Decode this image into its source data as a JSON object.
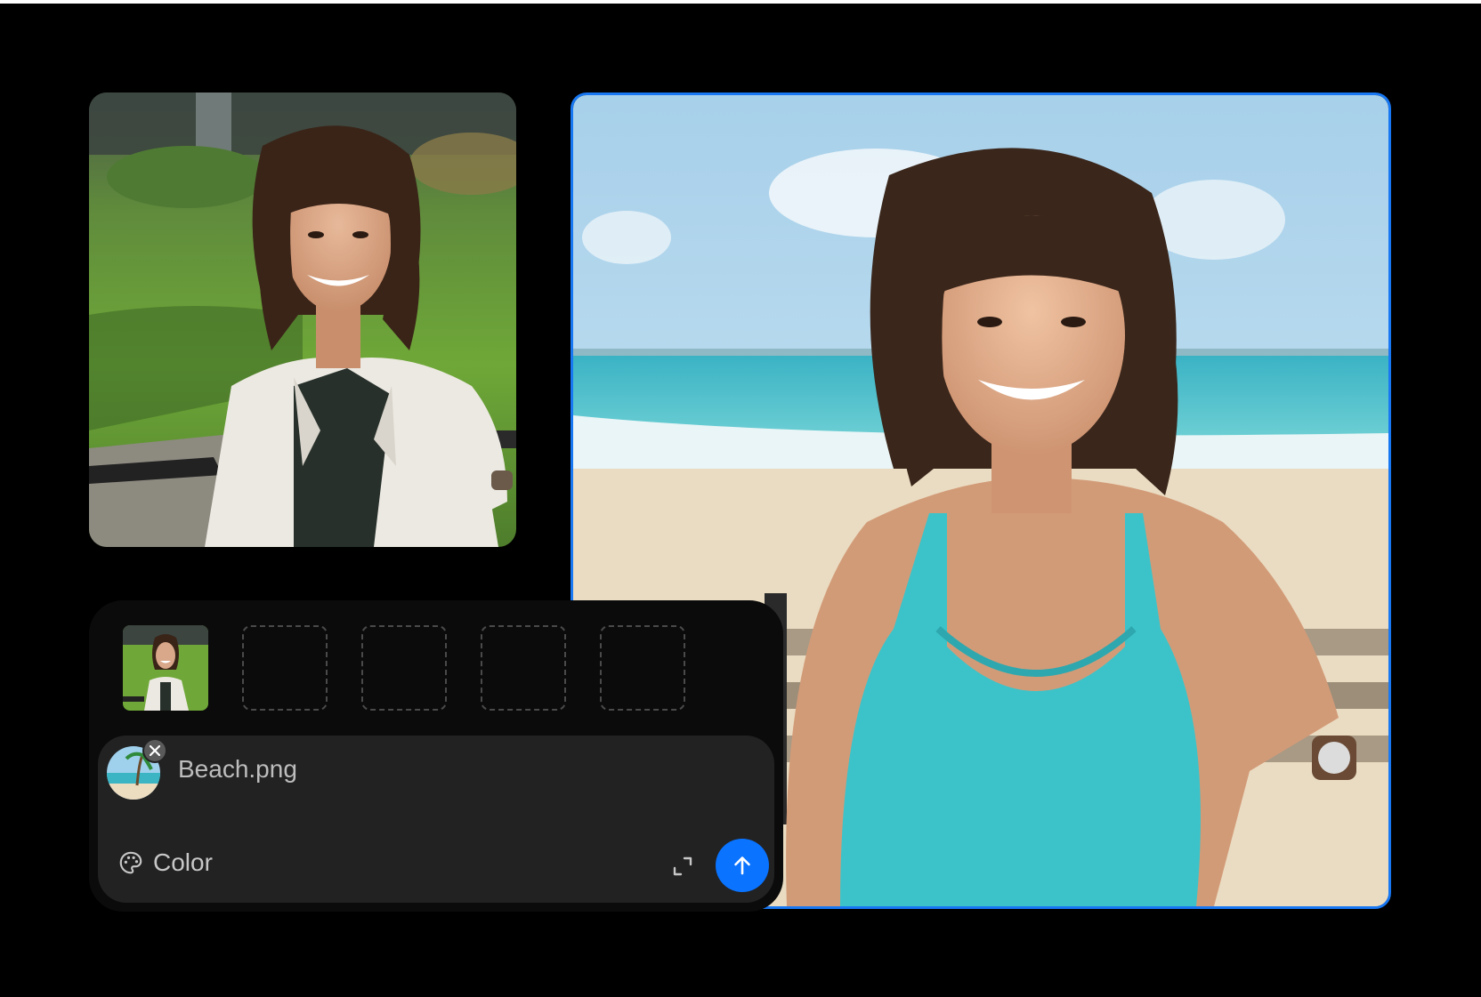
{
  "reference_slots": {
    "filled": [
      {
        "icon": "park-portrait-thumbnail"
      }
    ],
    "empty_count": 4
  },
  "composer": {
    "attachment": {
      "file_name": "Beach.png",
      "icon": "beach-image-thumbnail",
      "remove_icon": "close-icon"
    },
    "color_button": {
      "label": "Color",
      "icon": "palette-icon"
    },
    "expand_icon": "expand-icon",
    "send_icon": "arrow-up-icon"
  },
  "colors": {
    "accent": "#0a73ff",
    "selection_border": "#1877f2",
    "panel_bg": "#0b0b0b",
    "composer_bg": "#222222"
  }
}
